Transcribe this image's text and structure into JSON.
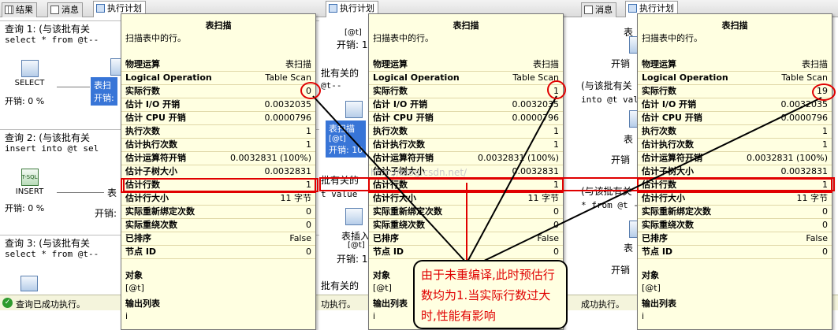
{
  "panels": [
    {
      "tabs": [
        {
          "label": "结果",
          "icon": "grid-icon"
        },
        {
          "label": "消息",
          "icon": "message-icon"
        },
        {
          "label": "执行计划",
          "icon": "plan-icon"
        }
      ],
      "queries": [
        {
          "title": "查询 1: (与该批有关",
          "sql": "select * from @t--"
        },
        {
          "title": "查询 2: (与该批有关",
          "sql": "insert into @t sel"
        },
        {
          "title": "查询 3: (与该批有关",
          "sql": "select * from @t--"
        }
      ],
      "ops": [
        {
          "label": "SELECT",
          "cost": "开销: 0 %",
          "selected_label": "表扫",
          "selected_cost": "开销:"
        },
        {
          "label": "INSERT",
          "cost": "开销: 0 %",
          "icon_text": "T-SQL",
          "side_label": "表",
          "side_cost": "开销:"
        }
      ],
      "status": "查询已成功执行。"
    },
    {
      "tabs": [
        {
          "label": "执行计划",
          "icon": "plan-icon"
        }
      ],
      "fragments": {
        "f1": "[@t]",
        "f2": "开销: 10",
        "f3": "批有关的",
        "f4": "@t--",
        "f5": "表扫描",
        "f6": "[@t]",
        "f7": "开销: 10",
        "f8": "批有关的",
        "f9": "t value",
        "f10": "表插入",
        "f11": "[@t]",
        "f12": "开销: 10",
        "f13": "批有关的",
        "f14": "功执行。"
      }
    },
    {
      "tabs": [
        {
          "label": "消息",
          "icon": "message-icon"
        },
        {
          "label": "执行计划",
          "icon": "plan-icon"
        }
      ],
      "fragments": {
        "f1": "表",
        "f2": "开销",
        "f3": "(与该批有关",
        "f4": "into @t val",
        "f5": "表",
        "f6": "开销",
        "f7": "(与该批有关",
        "f8": "* from @t -",
        "f9": "表",
        "f10": "开销",
        "f11": "成功执行。"
      }
    }
  ],
  "tooltips": [
    {
      "title": "表扫描",
      "desc": "扫描表中的行。",
      "rows": [
        {
          "label": "物理运算",
          "value": "表扫描"
        },
        {
          "label": "Logical Operation",
          "value": "Table Scan"
        },
        {
          "label": "实际行数",
          "value": "0"
        },
        {
          "label": "估计 I/O 开销",
          "value": "0.0032035"
        },
        {
          "label": "估计 CPU 开销",
          "value": "0.0000796"
        },
        {
          "label": "执行次数",
          "value": "1"
        },
        {
          "label": "估计执行次数",
          "value": "1"
        },
        {
          "label": "估计运算符开销",
          "value": "0.0032831 (100%)"
        },
        {
          "label": "估计子树大小",
          "value": "0.0032831"
        },
        {
          "label": "估计行数",
          "value": "1"
        },
        {
          "label": "估计行大小",
          "value": "11 字节"
        },
        {
          "label": "实际重新绑定次数",
          "value": "0"
        },
        {
          "label": "实际重绕次数",
          "value": "0"
        },
        {
          "label": "已排序",
          "value": "False"
        },
        {
          "label": "节点 ID",
          "value": "0"
        }
      ],
      "object_label": "对象",
      "object_value": "[@t]",
      "output_label": "输出列表",
      "output_value": "i"
    },
    {
      "title": "表扫描",
      "desc": "扫描表中的行。",
      "rows": [
        {
          "label": "物理运算",
          "value": "表扫描"
        },
        {
          "label": "Logical Operation",
          "value": "Table Scan"
        },
        {
          "label": "实际行数",
          "value": "1"
        },
        {
          "label": "估计 I/O 开销",
          "value": "0.0032035"
        },
        {
          "label": "估计 CPU 开销",
          "value": "0.0000796"
        },
        {
          "label": "执行次数",
          "value": "1"
        },
        {
          "label": "估计执行次数",
          "value": "1"
        },
        {
          "label": "估计运算符开销",
          "value": "0.0032831 (100%)"
        },
        {
          "label": "估计子树大小",
          "value": "0.0032831"
        },
        {
          "label": "估计行数",
          "value": "1"
        },
        {
          "label": "估计行大小",
          "value": "11 字节"
        },
        {
          "label": "实际重新绑定次数",
          "value": "0"
        },
        {
          "label": "实际重绕次数",
          "value": "0"
        },
        {
          "label": "已排序",
          "value": "False"
        },
        {
          "label": "节点 ID",
          "value": "0"
        }
      ],
      "object_label": "对象",
      "object_value": "[@t]",
      "output_label": "输出列表",
      "output_value": "i"
    },
    {
      "title": "表扫描",
      "desc": "扫描表中的行。",
      "rows": [
        {
          "label": "物理运算",
          "value": "表扫描"
        },
        {
          "label": "Logical Operation",
          "value": "Table Scan"
        },
        {
          "label": "实际行数",
          "value": "19"
        },
        {
          "label": "估计 I/O 开销",
          "value": "0.0032035"
        },
        {
          "label": "估计 CPU 开销",
          "value": "0.0000796"
        },
        {
          "label": "执行次数",
          "value": "1"
        },
        {
          "label": "估计执行次数",
          "value": "1"
        },
        {
          "label": "估计运算符开销",
          "value": "0.0032831 (100%)"
        },
        {
          "label": "估计子树大小",
          "value": "0.0032831"
        },
        {
          "label": "估计行数",
          "value": "1"
        },
        {
          "label": "估计行大小",
          "value": "11 字节"
        },
        {
          "label": "实际重新绑定次数",
          "value": "0"
        },
        {
          "label": "实际重绕次数",
          "value": "0"
        },
        {
          "label": "已排序",
          "value": "False"
        },
        {
          "label": "节点 ID",
          "value": "0"
        }
      ],
      "object_label": "对象",
      "object_value": "[@t]",
      "output_label": "输出列表",
      "output_value": "i"
    }
  ],
  "annotation": {
    "text": "由于未重编译,此时预估行数均为1.当实际行数过大时,性能有影响",
    "color": "#e00000"
  },
  "watermark": "http://blog.csdn.net/"
}
